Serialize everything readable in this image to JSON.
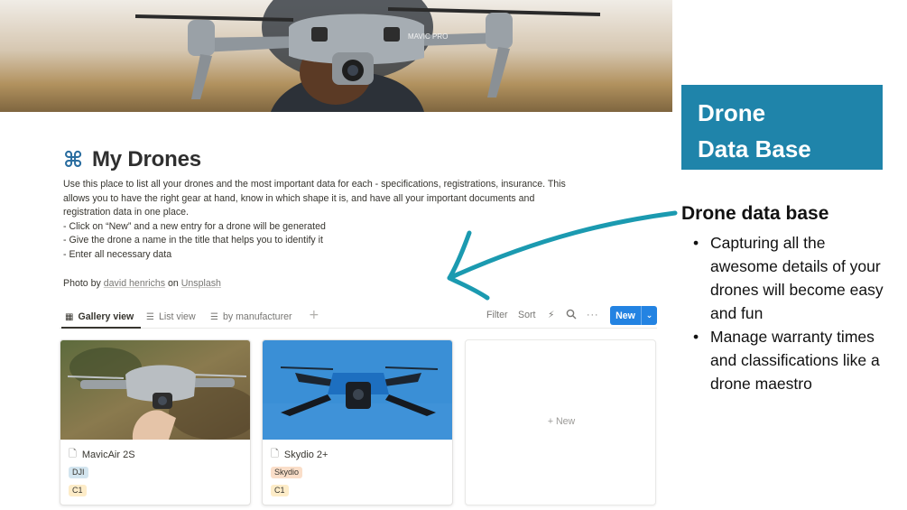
{
  "cover": {
    "drone_label": "MAVIC PRO"
  },
  "page": {
    "icon": "command-icon",
    "title": "My Drones",
    "description": [
      "Use this place to list all your drones and the most important data for each - specifications, registrations, insurance. This",
      "allows you to have the right gear at hand, know in which shape it is, and have all your important documents and",
      "registration data in one place.",
      "- Click on “New” and a new entry for a drone will be generated",
      "- Give the drone a name in the title that helps you to identify it",
      "- Enter all necessary data",
      ""
    ],
    "photo_credit": {
      "prefix": "Photo by ",
      "author": "david henrichs",
      "middle": " on ",
      "source": "Unsplash"
    }
  },
  "views": {
    "tabs": [
      {
        "label": "Gallery view",
        "icon": "gallery-grid-icon",
        "active": true
      },
      {
        "label": "List view",
        "icon": "list-icon",
        "active": false
      },
      {
        "label": "by manufacturer",
        "icon": "list-icon",
        "active": false
      }
    ],
    "add_view": "+",
    "tools": {
      "filter": "Filter",
      "sort": "Sort",
      "automation": "⚡",
      "search": "search-icon",
      "more": "···"
    },
    "new_button": {
      "label": "New",
      "dropdown": "⌄"
    }
  },
  "cards": [
    {
      "title": "MavicAir 2S",
      "manufacturer": "DJI",
      "class": "C1"
    },
    {
      "title": "Skydio 2+",
      "manufacturer": "Skydio",
      "class": "C1"
    }
  ],
  "empty_card": {
    "label": "+ New"
  },
  "annotation": {
    "banner_lines": [
      "Drone",
      "Data Base"
    ],
    "heading": "Drone data base",
    "bullets": [
      "Capturing all the awesome details of your drones will become easy and fun",
      "Manage warranty times and classifications like a drone maestro"
    ]
  },
  "colors": {
    "banner": "#1f84aa",
    "arrow": "#1b9ab0",
    "new_button": "#2383e2",
    "tag_dji": "#d3e5ef",
    "tag_skydio": "#fadec9",
    "tag_class": "#fdecc8"
  }
}
